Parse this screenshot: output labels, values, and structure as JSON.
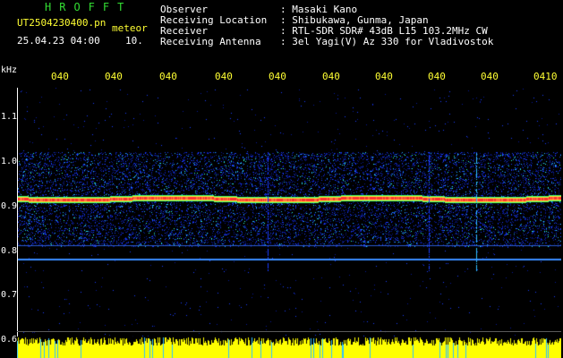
{
  "header": {
    "program_name": "HROFFT",
    "filename": "UT2504230400.pn",
    "meteor_label": "meteor",
    "datetime": "25.04.23 04:00",
    "count": "10.",
    "fields": [
      {
        "label": "Observer",
        "value": ": Masaki Kano"
      },
      {
        "label": "Receiving Location",
        "value": ": Shibukawa, Gunma, Japan"
      },
      {
        "label": "Receiver",
        "value": ": RTL-SDR SDR# 43dB L15 103.2MHz CW"
      },
      {
        "label": "Receiving Antenna",
        "value": ": 3el Yagi(V) Az 330 for Vladivostok"
      }
    ]
  },
  "axis": {
    "unit": "kHz",
    "y_ticks": [
      "1.1",
      "1.0",
      "0.9",
      "0.8",
      "0.7",
      "0.6"
    ],
    "x_ticks": [
      "040",
      "040",
      "040",
      "040",
      "040",
      "040",
      "040",
      "040",
      "040",
      "0410"
    ]
  },
  "colors": {
    "background": "#000000",
    "header_text": "#ffffff",
    "tick_text": "#ffff33",
    "title_text": "#33dd33",
    "signal_line": "#ff3030",
    "noise_band": "#1a3cff",
    "indicator": "#ffff00"
  }
}
